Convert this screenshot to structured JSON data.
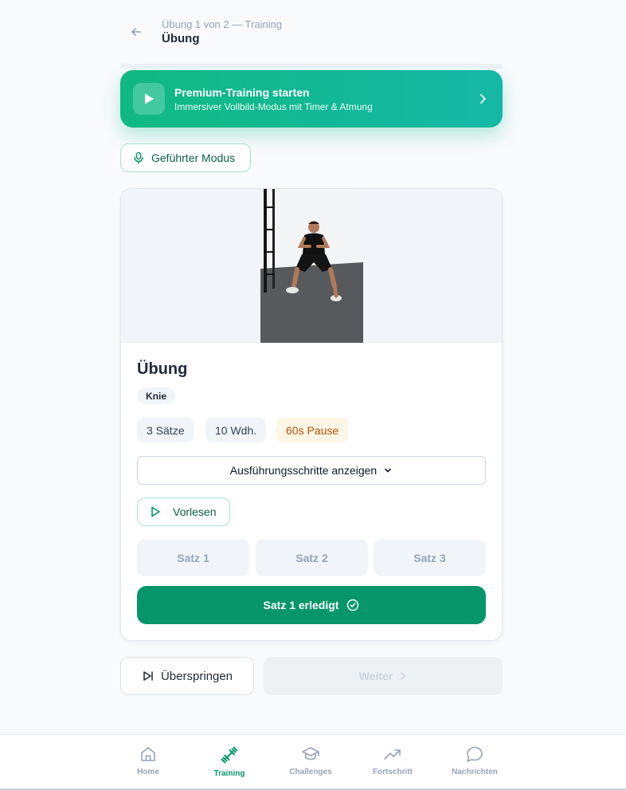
{
  "header": {
    "subtitle": "Übung 1 von 2 — Training",
    "title": "Übung"
  },
  "premium": {
    "title": "Premium-Training starten",
    "subtitle": "Immersiver Vollbild-Modus mit Timer & Atmung"
  },
  "guided_mode": {
    "label": "Geführter Modus"
  },
  "exercise": {
    "title": "Übung",
    "tag": "Knie",
    "stats": {
      "sets": "3 Sätze",
      "reps": "10 Wdh.",
      "pause": "60s Pause"
    },
    "steps_button": "Ausführungsschritte anzeigen",
    "read_aloud": "Vorlesen",
    "set_tabs": [
      "Satz 1",
      "Satz 2",
      "Satz 3"
    ],
    "done_button": "Satz 1 erledigt"
  },
  "actions": {
    "skip": "Überspringen",
    "next": "Weiter"
  },
  "nav": [
    {
      "label": "Home",
      "icon": "home-icon",
      "active": false
    },
    {
      "label": "Training",
      "icon": "dumbbell-icon",
      "active": true
    },
    {
      "label": "Challenges",
      "icon": "graduation-cap-icon",
      "active": false
    },
    {
      "label": "Fortschritt",
      "icon": "trend-up-icon",
      "active": false
    },
    {
      "label": "Nachrichten",
      "icon": "chat-bubble-icon",
      "active": false
    }
  ],
  "colors": {
    "accent": "#059669",
    "premium_gradient_start": "#10b981",
    "premium_gradient_end": "#14b8a6",
    "pause_text": "#b45309"
  }
}
